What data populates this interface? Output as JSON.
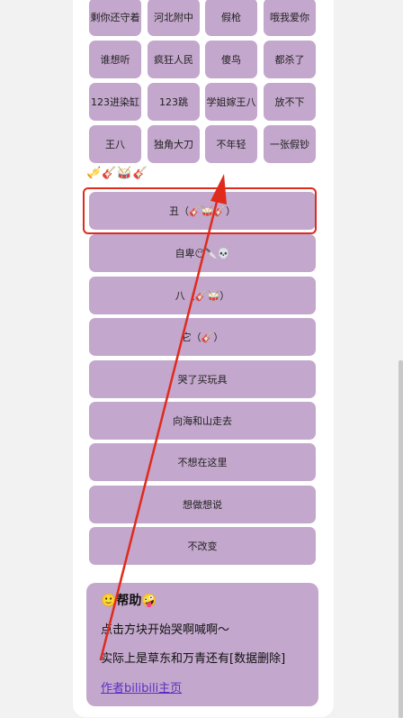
{
  "grid_tiles": [
    "剩你还守着",
    "河北附中",
    "假枪",
    "哦我爱你",
    "谁想听",
    "疯狂人民",
    "傻鸟",
    "都杀了",
    "123进染缸",
    "123跳",
    "学姐嫁王八",
    "放不下",
    "王八",
    "独角大刀",
    "不年轻",
    "一张假钞"
  ],
  "emoji_row": "🎺🎸🥁🎸",
  "song_list": [
    "丑（🎸🥁🎸）",
    "自卑😶🔪💀",
    "八（🎸🥁）",
    "它（🎸）",
    "哭了买玩具",
    "向海和山走去",
    "不想在这里",
    "想做想说",
    "不改变"
  ],
  "help": {
    "title": "🙂帮助🤪",
    "line1": "点击方块开始哭啊喊啊～",
    "line2": "实际上是草东和万青还有[数据删除]",
    "link": "作者bilibili主页"
  },
  "colors": {
    "tile": "#c3a7cc",
    "annotation": "#e02a1c",
    "link": "#5a2fc2"
  }
}
